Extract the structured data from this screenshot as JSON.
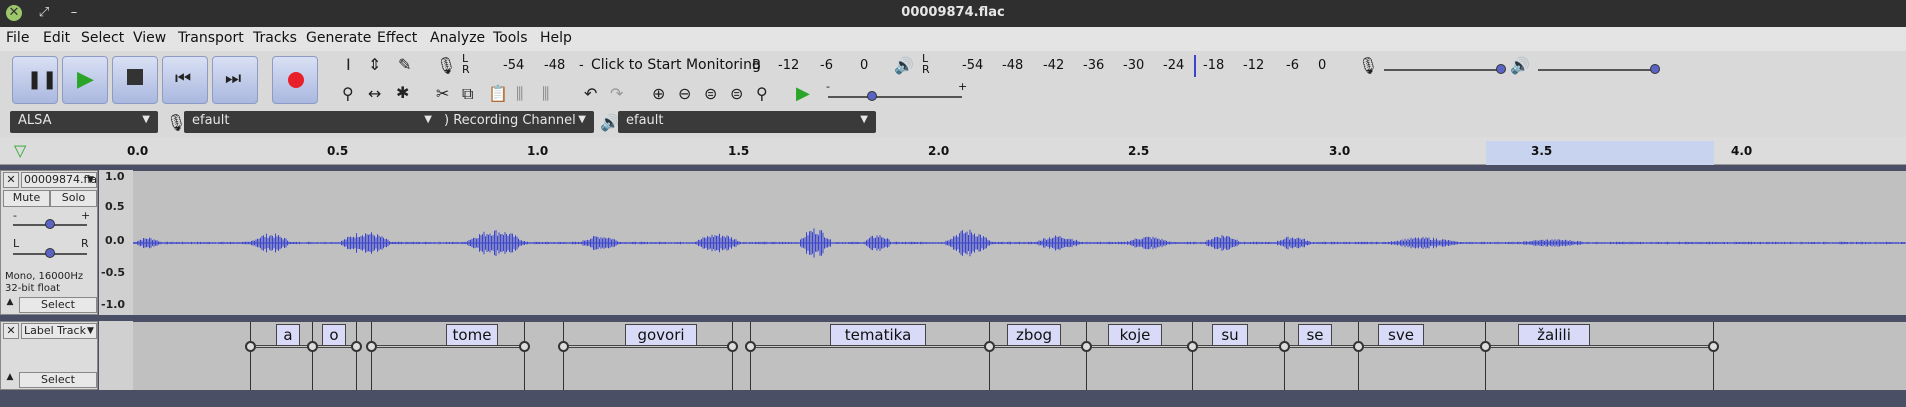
{
  "window": {
    "title": "00009874.flac"
  },
  "menubar": [
    "File",
    "Edit",
    "Select",
    "View",
    "Transport",
    "Tracks",
    "Generate",
    "Effect",
    "Analyze",
    "Tools",
    "Help"
  ],
  "meters": {
    "record_ticks": [
      "-54",
      "-48",
      "-",
      "-12",
      "-6",
      "0"
    ],
    "record_prompt": "Click to Start Monitoring",
    "record_b": "B",
    "play_ticks": [
      "-54",
      "-48",
      "-42",
      "-36",
      "-30",
      "-24",
      "-18",
      "-12",
      "-6",
      "0"
    ],
    "lr_l": "L",
    "lr_r": "R"
  },
  "devices": {
    "host": "ALSA",
    "recording_device": "efault",
    "recording_channel": ") Recording Channel",
    "playback_device": "efault"
  },
  "ruler": {
    "ticks": [
      "0.0",
      "0.5",
      "1.0",
      "1.5",
      "2.0",
      "2.5",
      "3.0",
      "3.5",
      "4.0"
    ]
  },
  "audio_track": {
    "name": "00009874.fla",
    "mute": "Mute",
    "solo": "Solo",
    "gain_minus": "-",
    "gain_plus": "+",
    "pan_l": "L",
    "pan_r": "R",
    "info1": "Mono, 16000Hz",
    "info2": "32-bit float",
    "select": "Select",
    "scale": [
      "1.0",
      "0.5",
      "0.0",
      "-0.5",
      "-1.0"
    ]
  },
  "label_track": {
    "name": "Label Track",
    "select": "Select",
    "labels": [
      "a",
      "o",
      "tome",
      "govori",
      "tematika",
      "zbog",
      "koje",
      "su",
      "se",
      "sve",
      "žalili"
    ]
  },
  "colors": {
    "waveform": "#3b44cc",
    "label_fill": "#d9daf8",
    "selection": "#c8d4ef",
    "record": "#e8202a",
    "play": "#2aa52a"
  }
}
